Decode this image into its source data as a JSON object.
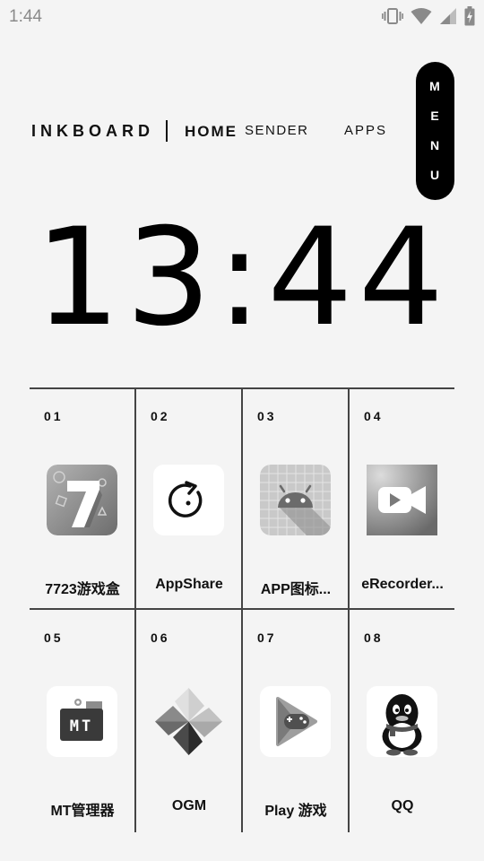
{
  "status_bar": {
    "time": "1:44",
    "icons": [
      "vibrate-icon",
      "wifi-icon",
      "signal-icon",
      "battery-charging-icon"
    ]
  },
  "nav": {
    "brand": "INKBOARD",
    "home": "HOME",
    "sender": "SENDER",
    "apps": "APPS",
    "menu_letters": [
      "M",
      "E",
      "N",
      "U"
    ]
  },
  "clock": {
    "time": "13:44"
  },
  "apps": [
    {
      "num": "01",
      "label": "7723游戏盒",
      "icon": "7723-icon"
    },
    {
      "num": "02",
      "label": "AppShare",
      "icon": "appshare-icon"
    },
    {
      "num": "03",
      "label": "APP图标...",
      "icon": "android-icon"
    },
    {
      "num": "04",
      "label": "eRecorder...",
      "icon": "video-camera-icon"
    },
    {
      "num": "05",
      "label": "MT管理器",
      "icon": "mt-icon"
    },
    {
      "num": "06",
      "label": "OGM",
      "icon": "pinwheel-icon"
    },
    {
      "num": "07",
      "label": "Play 游戏",
      "icon": "play-games-icon"
    },
    {
      "num": "08",
      "label": "QQ",
      "icon": "qq-penguin-icon"
    }
  ]
}
